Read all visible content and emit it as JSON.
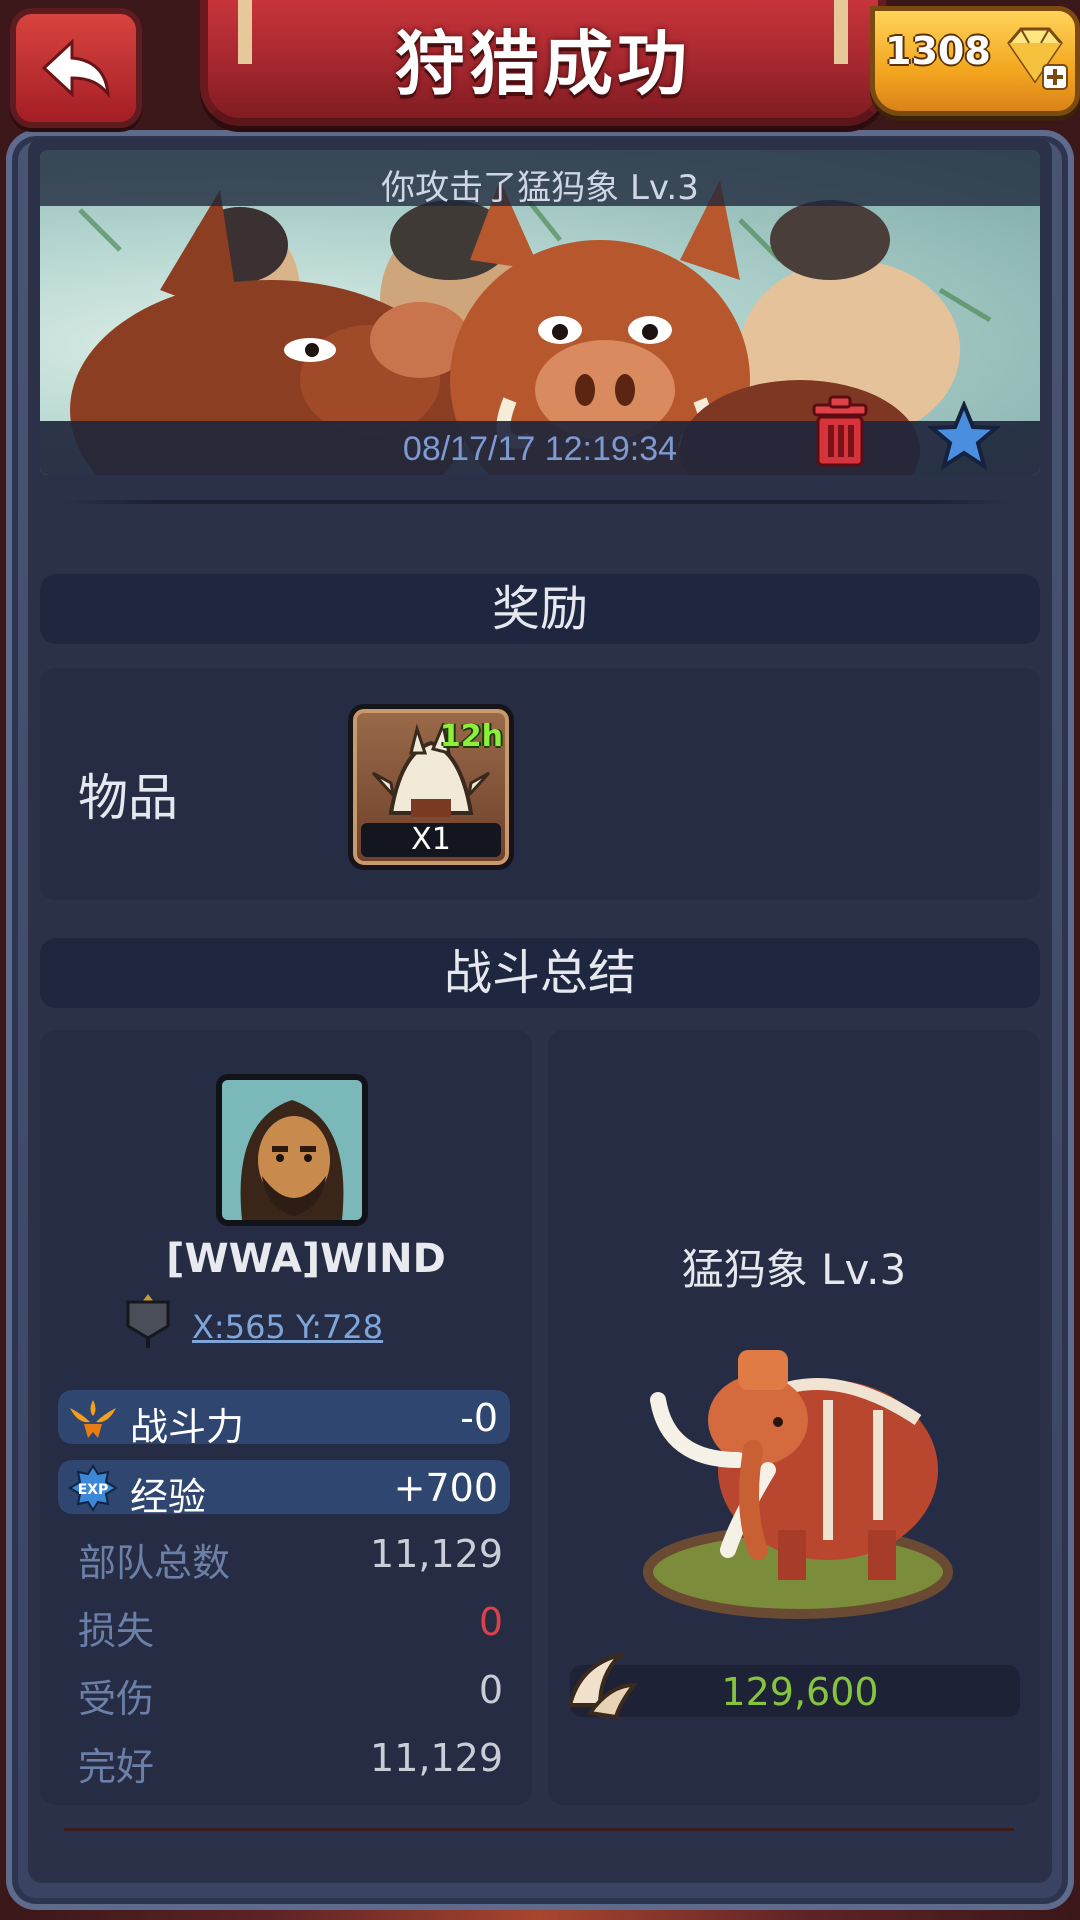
{
  "header": {
    "title": "狩猎成功",
    "gems": "1308"
  },
  "report": {
    "caption": "你攻击了猛犸象 Lv.3",
    "datetime": "08/17/17 12:19:34"
  },
  "rewards": {
    "section_title": "奖励",
    "items_label": "物品",
    "item": {
      "timer": "12h",
      "quantity": "X1"
    }
  },
  "summary": {
    "section_title": "战斗总结",
    "player": {
      "name": "[WWA]WIND",
      "coords": "X:565 Y:728",
      "power_label": "战斗力",
      "power_value": "-0",
      "exp_label": "经验",
      "exp_value": "+700",
      "rows": [
        {
          "label": "部队总数",
          "value": "11,129"
        },
        {
          "label": "损失",
          "value": "0"
        },
        {
          "label": "受伤",
          "value": "0"
        },
        {
          "label": "完好",
          "value": "11,129"
        }
      ]
    },
    "monster": {
      "name": "猛犸象 Lv.3",
      "resource_value": "129,600"
    }
  },
  "colors": {
    "loss_value": "#d9424a",
    "resource_value": "#86c440",
    "coords_link": "#7ea4d8"
  }
}
